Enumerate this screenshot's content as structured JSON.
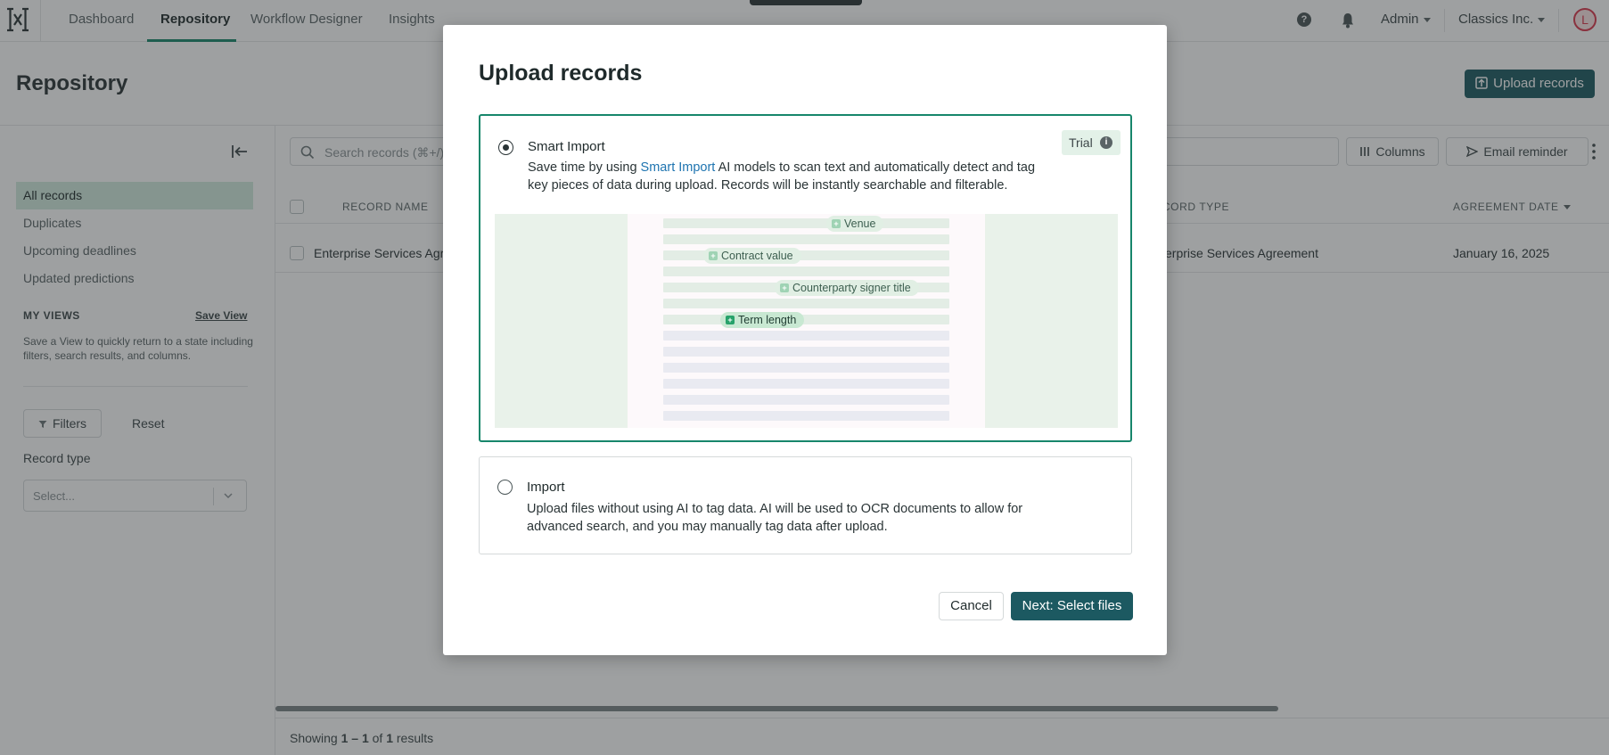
{
  "nav": {
    "items": [
      {
        "label": "Dashboard",
        "active": false
      },
      {
        "label": "Repository",
        "active": true
      },
      {
        "label": "Workflow Designer",
        "active": false
      },
      {
        "label": "Insights",
        "active": false
      }
    ],
    "right": {
      "user_menu": "Admin",
      "org_menu": "Classics Inc.",
      "avatar_initial": "L",
      "help_icon": "?"
    }
  },
  "header": {
    "title": "Repository",
    "upload_button": "Upload records"
  },
  "sidebar": {
    "items": [
      {
        "label": "All records",
        "active": true
      },
      {
        "label": "Duplicates",
        "active": false
      },
      {
        "label": "Upcoming deadlines",
        "active": false
      },
      {
        "label": "Updated predictions",
        "active": false
      }
    ],
    "my_views_heading": "MY VIEWS",
    "save_view_link": "Save View",
    "views_note": "Save a View to quickly return to a state including filters, search results, and columns.",
    "filters_button": "Filters",
    "reset_button": "Reset",
    "record_type_label": "Record type",
    "record_type_placeholder": "Select..."
  },
  "toolbar": {
    "search_placeholder": "Search records (⌘+/)",
    "columns_button": "Columns",
    "email_reminder_button": "Email reminder"
  },
  "table": {
    "columns": [
      "RECORD NAME",
      "RECORD TYPE",
      "AGREEMENT DATE"
    ],
    "rows": [
      {
        "name": "Enterprise Services Agreement",
        "type": "Enterprise Services Agreement",
        "date": "January 16, 2025"
      }
    ]
  },
  "footer": {
    "prefix": "Showing ",
    "range": "1 – 1",
    "mid": " of ",
    "total": "1",
    "suffix": " results"
  },
  "modal": {
    "title": "Upload records",
    "smart": {
      "title": "Smart Import",
      "badge": "Trial",
      "badge_info_icon": "i",
      "desc_prefix": "Save time by using ",
      "desc_link": "Smart Import",
      "desc_suffix": " AI models to scan text and automatically detect and tag key pieces of data during upload. Records will be instantly searchable and filterable.",
      "tags": [
        "Venue",
        "Contract value",
        "Counterparty signer title",
        "Term length"
      ],
      "selected": true
    },
    "plain": {
      "title": "Import",
      "desc": "Upload files without using AI to tag data. AI will be used to OCR documents to allow for advanced search, and you may manually tag data after upload.",
      "selected": false
    },
    "cancel_button": "Cancel",
    "next_button": "Next: Select files"
  },
  "colors": {
    "accent_green": "#17866b",
    "primary_button": "#1c5961",
    "link_blue": "#1e74b0",
    "selected_sidebar": "#d2ecdf",
    "avatar_red": "#d9364b"
  }
}
